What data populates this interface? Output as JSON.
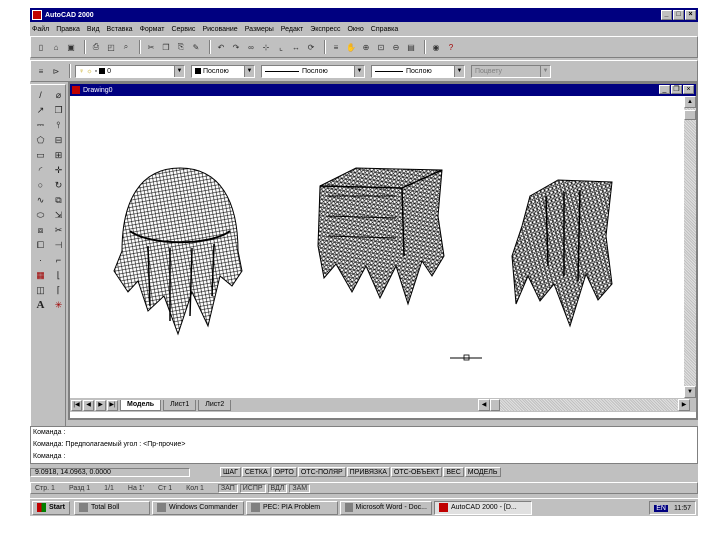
{
  "app": {
    "title": "AutoCAD 2000"
  },
  "menu": [
    "Файл",
    "Правка",
    "Вид",
    "Вставка",
    "Формат",
    "Сервис",
    "Рисование",
    "Размеры",
    "Редакт",
    "Экспресс",
    "Окно",
    "Справка"
  ],
  "toolbar1_icons": [
    "new-icon",
    "open-icon",
    "save-icon",
    "print-icon",
    "preview-icon",
    "find-icon",
    "cut-icon",
    "copy-icon",
    "paste-icon",
    "matchprop-icon",
    "undo-icon",
    "redo-icon",
    "hyperlink-icon",
    "snap-icon",
    "ucs-icon",
    "distance-icon",
    "redraw-icon",
    "layers-icon",
    "pan-icon",
    "zoom-realtime-icon",
    "zoom-window-icon",
    "zoom-previous-icon",
    "properties-icon",
    "designcenter-icon",
    "help-icon"
  ],
  "toolbar2": {
    "layer_value": "0",
    "color_value": "Послою",
    "linetype_value": "Послою",
    "lineweight_value": "Послою",
    "plotstyle_value": "Поцвету"
  },
  "draw_tools": [
    {
      "icon": "line-icon",
      "glyph": "/"
    },
    {
      "icon": "erase-icon",
      "glyph": "⌀"
    },
    {
      "icon": "construction-line-icon",
      "glyph": "↗"
    },
    {
      "icon": "copy-object-icon",
      "glyph": "❐"
    },
    {
      "icon": "polyline-icon",
      "glyph": "⎓"
    },
    {
      "icon": "mirror-icon",
      "glyph": "⫯"
    },
    {
      "icon": "polygon-icon",
      "glyph": "⬠"
    },
    {
      "icon": "offset-icon",
      "glyph": "⊟"
    },
    {
      "icon": "rectangle-icon",
      "glyph": "▭"
    },
    {
      "icon": "array-icon",
      "glyph": "⊞"
    },
    {
      "icon": "arc-icon",
      "glyph": "◜"
    },
    {
      "icon": "move-icon",
      "glyph": "✛"
    },
    {
      "icon": "circle-icon",
      "glyph": "○"
    },
    {
      "icon": "rotate-icon",
      "glyph": "↻"
    },
    {
      "icon": "spline-icon",
      "glyph": "∿"
    },
    {
      "icon": "scale-icon",
      "glyph": "⧉"
    },
    {
      "icon": "ellipse-icon",
      "glyph": "⬭"
    },
    {
      "icon": "stretch-icon",
      "glyph": "⇲"
    },
    {
      "icon": "insert-block-icon",
      "glyph": "⧈"
    },
    {
      "icon": "trim-icon",
      "glyph": "✂"
    },
    {
      "icon": "make-block-icon",
      "glyph": "⧠"
    },
    {
      "icon": "extend-icon",
      "glyph": "⊣"
    },
    {
      "icon": "point-icon",
      "glyph": "·"
    },
    {
      "icon": "break-icon",
      "glyph": "⌐"
    },
    {
      "icon": "hatch-icon",
      "glyph": "▦"
    },
    {
      "icon": "chamfer-icon",
      "glyph": "⌊"
    },
    {
      "icon": "region-icon",
      "glyph": "◫"
    },
    {
      "icon": "fillet-icon",
      "glyph": "⌈"
    },
    {
      "icon": "text-icon",
      "glyph": "A"
    },
    {
      "icon": "explode-icon",
      "glyph": "✳"
    }
  ],
  "drawing_window": {
    "title": "Drawing0"
  },
  "layout_tabs": [
    "Модель",
    "Лист1",
    "Лист2"
  ],
  "command_lines": [
    "Команда :",
    "Команда: Предполагаемый угол : <Пр-прочие>",
    "Команда :"
  ],
  "status": {
    "coords": "9.0918, 14.0963, 0.0000",
    "buttons": [
      "ШАГ",
      "СЕТКА",
      "ОРТО",
      "ОТС-ПОЛЯР",
      "ПРИВЯЗКА",
      "ОТС-ОБЪЕКТ",
      "ВЕС",
      "МОДЕЛЬ"
    ]
  },
  "secondary_bar": [
    "Стр. 1",
    "Разд 1",
    "1/1",
    "На 1'",
    "Ст 1",
    "Кол 1",
    "ЗАП",
    "ИСПР",
    "ВДЛ",
    "ЗАМ"
  ],
  "taskbar": {
    "start": "Start",
    "tasks": [
      "Total Boll",
      "Windows Commander",
      "PEC: PIA Problem",
      "Microsoft Word - Doc...",
      "AutoCAD 2000 - [D..."
    ],
    "lang": "EN",
    "clock": "11:57"
  }
}
